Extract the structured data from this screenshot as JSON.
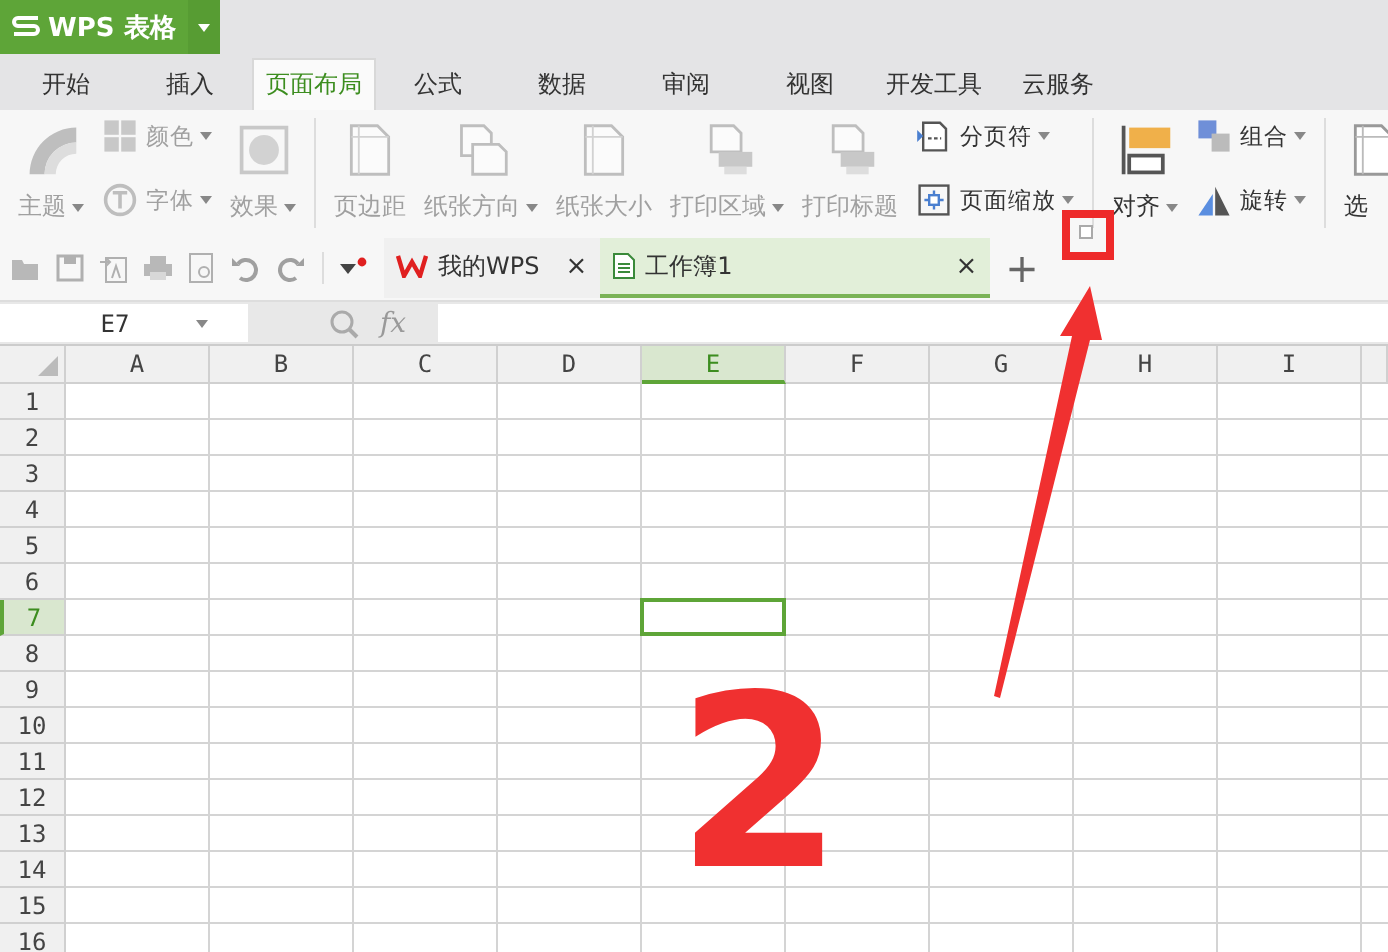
{
  "app_button": {
    "title": "WPS 表格"
  },
  "tabs": [
    {
      "label": "开始",
      "selected": false
    },
    {
      "label": "插入",
      "selected": false
    },
    {
      "label": "页面布局",
      "selected": true
    },
    {
      "label": "公式",
      "selected": false
    },
    {
      "label": "数据",
      "selected": false
    },
    {
      "label": "审阅",
      "selected": false
    },
    {
      "label": "视图",
      "selected": false
    },
    {
      "label": "开发工具",
      "selected": false
    },
    {
      "label": "云服务",
      "selected": false
    }
  ],
  "ribbon_groups": [
    {
      "columns": [
        [
          {
            "label": "主题",
            "disabled": true,
            "dropdown": true
          }
        ],
        [
          {
            "label": "颜色",
            "disabled": true,
            "dropdown": true
          },
          {
            "label": "字体",
            "disabled": true,
            "dropdown": true
          }
        ],
        [
          {
            "label": "效果",
            "disabled": true,
            "dropdown": true
          }
        ]
      ]
    },
    {
      "columns": [
        [
          {
            "label": "页边距",
            "disabled": true,
            "dropdown": false
          }
        ],
        [
          {
            "label": "纸张方向",
            "disabled": true,
            "dropdown": true
          }
        ],
        [
          {
            "label": "纸张大小",
            "disabled": true,
            "dropdown": false
          }
        ],
        [
          {
            "label": "打印区域",
            "disabled": true,
            "dropdown": true
          }
        ],
        [
          {
            "label": "打印标题",
            "disabled": true,
            "dropdown": false
          }
        ],
        [
          {
            "label": "分页符",
            "disabled": false,
            "dropdown": true
          },
          {
            "label": "页面缩放",
            "disabled": false,
            "dropdown": true
          }
        ]
      ]
    },
    {
      "columns": [
        [
          {
            "label": "对齐",
            "disabled": false,
            "dropdown": true
          }
        ],
        [
          {
            "label": "组合",
            "disabled": false,
            "dropdown": true
          },
          {
            "label": "旋转",
            "disabled": false,
            "dropdown": true
          }
        ]
      ]
    },
    {
      "columns": [
        [
          {
            "label": "选",
            "disabled": false,
            "dropdown": false
          }
        ]
      ]
    }
  ],
  "doc_tabs": [
    {
      "label": "我的WPS",
      "close": "×",
      "selected": false
    },
    {
      "label": "工作簿1",
      "close": "×",
      "selected": true
    }
  ],
  "new_tab": "+",
  "formula_bar": {
    "name_box": "E7",
    "fx": "fx"
  },
  "sheet": {
    "columns": [
      {
        "label": "A",
        "selected": false
      },
      {
        "label": "B",
        "selected": false
      },
      {
        "label": "C",
        "selected": false
      },
      {
        "label": "D",
        "selected": false
      },
      {
        "label": "E",
        "selected": true
      },
      {
        "label": "F",
        "selected": false
      },
      {
        "label": "G",
        "selected": false
      },
      {
        "label": "H",
        "selected": false
      },
      {
        "label": "I",
        "selected": false
      }
    ],
    "rows": [
      {
        "label": "1",
        "selected": false
      },
      {
        "label": "2",
        "selected": false
      },
      {
        "label": "3",
        "selected": false
      },
      {
        "label": "4",
        "selected": false
      },
      {
        "label": "5",
        "selected": false
      },
      {
        "label": "6",
        "selected": false
      },
      {
        "label": "7",
        "selected": true
      },
      {
        "label": "8",
        "selected": false
      },
      {
        "label": "9",
        "selected": false
      },
      {
        "label": "10",
        "selected": false
      },
      {
        "label": "11",
        "selected": false
      },
      {
        "label": "12",
        "selected": false
      },
      {
        "label": "13",
        "selected": false
      },
      {
        "label": "14",
        "selected": false
      },
      {
        "label": "15",
        "selected": false
      },
      {
        "label": "16",
        "selected": false
      }
    ]
  },
  "annotation": {
    "number": "2"
  }
}
